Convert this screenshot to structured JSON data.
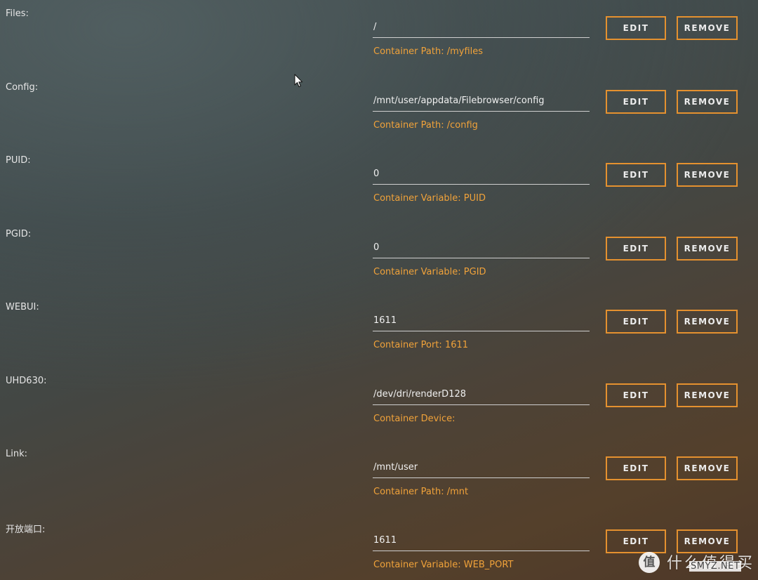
{
  "rows": [
    {
      "label": "Files:",
      "value": "/",
      "description": "Container Path: /myfiles",
      "edit_label": "EDIT",
      "remove_label": "REMOVE"
    },
    {
      "label": "Config:",
      "value": "/mnt/user/appdata/Filebrowser/config",
      "description": "Container Path: /config",
      "edit_label": "EDIT",
      "remove_label": "REMOVE"
    },
    {
      "label": "PUID:",
      "value": "0",
      "description": "Container Variable: PUID",
      "edit_label": "EDIT",
      "remove_label": "REMOVE"
    },
    {
      "label": "PGID:",
      "value": "0",
      "description": "Container Variable: PGID",
      "edit_label": "EDIT",
      "remove_label": "REMOVE"
    },
    {
      "label": "WEBUI:",
      "value": "1611",
      "description": "Container Port: 1611",
      "edit_label": "EDIT",
      "remove_label": "REMOVE"
    },
    {
      "label": "UHD630:",
      "value": "/dev/dri/renderD128",
      "description": "Container Device:",
      "edit_label": "EDIT",
      "remove_label": "REMOVE"
    },
    {
      "label": "Link:",
      "value": "/mnt/user",
      "description": "Container Path: /mnt",
      "edit_label": "EDIT",
      "remove_label": "REMOVE"
    },
    {
      "label": "开放端口:",
      "value": "1611",
      "description": "Container Variable: WEB_PORT",
      "edit_label": "EDIT",
      "remove_label": "REMOVE"
    }
  ],
  "watermark": {
    "badge": "值",
    "text": "什么值得买",
    "sub": "SMYZ.NET"
  },
  "colors": {
    "accent": "#e5912f",
    "description_text": "#f0a23a",
    "label_text": "#e6e6e6"
  },
  "icons": {
    "cursor": "mouse-pointer-icon"
  }
}
